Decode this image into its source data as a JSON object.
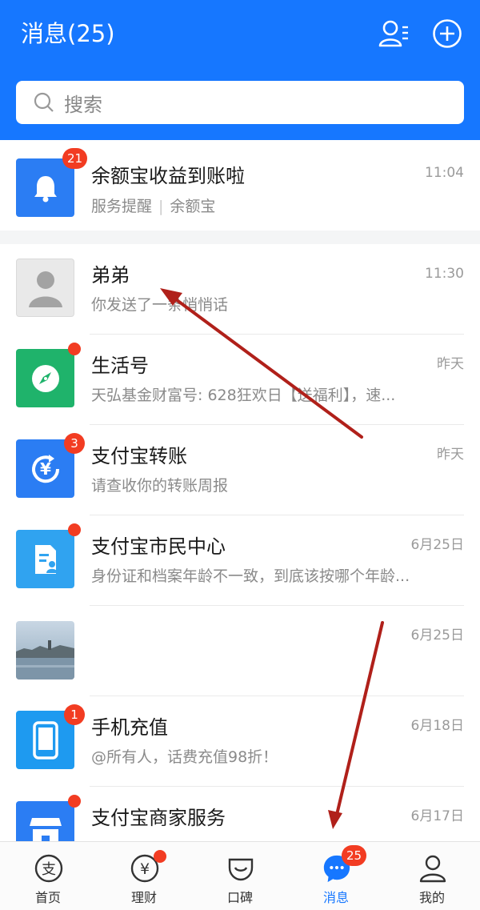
{
  "header": {
    "title": "消息(25)",
    "search_placeholder": "搜索",
    "contacts_icon": "contacts-icon",
    "add_icon": "plus-circle-icon",
    "bg_color": "#1677ff"
  },
  "messages": [
    {
      "title": "余额宝收益到账啦",
      "subtitle_a": "服务提醒",
      "subtitle_b": "余额宝",
      "time": "11:04",
      "badge": "21",
      "icon": "bell-icon"
    },
    {
      "title": "弟弟",
      "subtitle": "你发送了一条悄悄话",
      "time": "11:30",
      "icon": "default-avatar-icon"
    },
    {
      "title": "生活号",
      "subtitle": "天弘基金财富号: 628狂欢日【送福利】，速...",
      "time": "昨天",
      "icon": "compass-icon"
    },
    {
      "title": "支付宝转账",
      "subtitle": "请查收你的转账周报",
      "time": "昨天",
      "badge": "3",
      "icon": "yuan-transfer-icon"
    },
    {
      "title": "支付宝市民中心",
      "subtitle": "身份证和档案年龄不一致，到底该按哪个年龄...",
      "time": "6月25日",
      "icon": "citizen-card-icon"
    },
    {
      "title": "",
      "subtitle": "",
      "time": "6月25日",
      "icon": "landscape-photo-avatar"
    },
    {
      "title": "手机充值",
      "subtitle": "@所有人，话费充值98折！",
      "time": "6月18日",
      "badge": "1",
      "icon": "phone-icon"
    },
    {
      "title": "支付宝商家服务",
      "subtitle": "",
      "time": "6月17日",
      "icon": "shop-icon"
    }
  ],
  "tabbar": {
    "tabs": [
      {
        "label": "首页",
        "icon": "alipay-home-icon"
      },
      {
        "label": "理财",
        "icon": "yuan-wealth-icon"
      },
      {
        "label": "口碑",
        "icon": "koubei-icon"
      },
      {
        "label": "消息",
        "icon": "chat-bubble-icon",
        "badge": "25"
      },
      {
        "label": "我的",
        "icon": "person-icon"
      }
    ],
    "active_color": "#1677ff"
  },
  "annotation_color": "#b0201a"
}
